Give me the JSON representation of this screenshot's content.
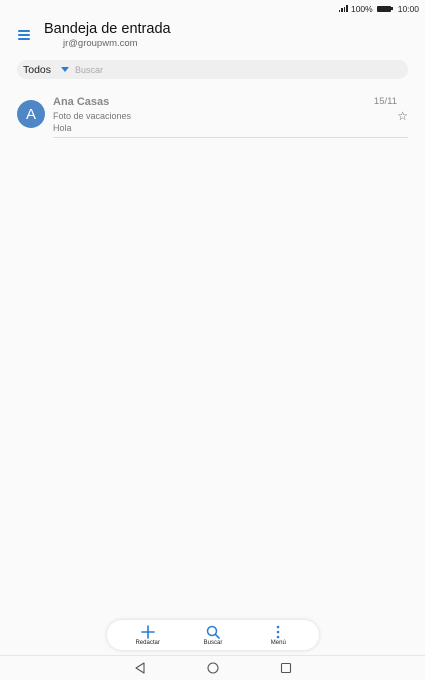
{
  "status_bar": {
    "battery": "100%",
    "time": "10:00"
  },
  "header": {
    "title": "Bandeja de entrada",
    "account": "jr@groupwm.com"
  },
  "filter": {
    "label": "Todos",
    "search_placeholder": "Buscar"
  },
  "messages": [
    {
      "avatar_letter": "A",
      "sender": "Ana Casas",
      "subject": "Foto de vacaciones",
      "preview": "Hola",
      "date": "15/11",
      "starred": false
    }
  ],
  "bottom_bar": {
    "compose": "Redactar",
    "search": "Buscar",
    "menu": "Menú"
  },
  "colors": {
    "accent": "#2a7ed3",
    "avatar": "#4f86c6",
    "background": "#fafafa"
  },
  "icons": {
    "menu": "hamburger-icon",
    "compose": "plus-icon",
    "search": "search-icon",
    "more": "more-vertical-icon",
    "star": "star-outline-icon"
  }
}
